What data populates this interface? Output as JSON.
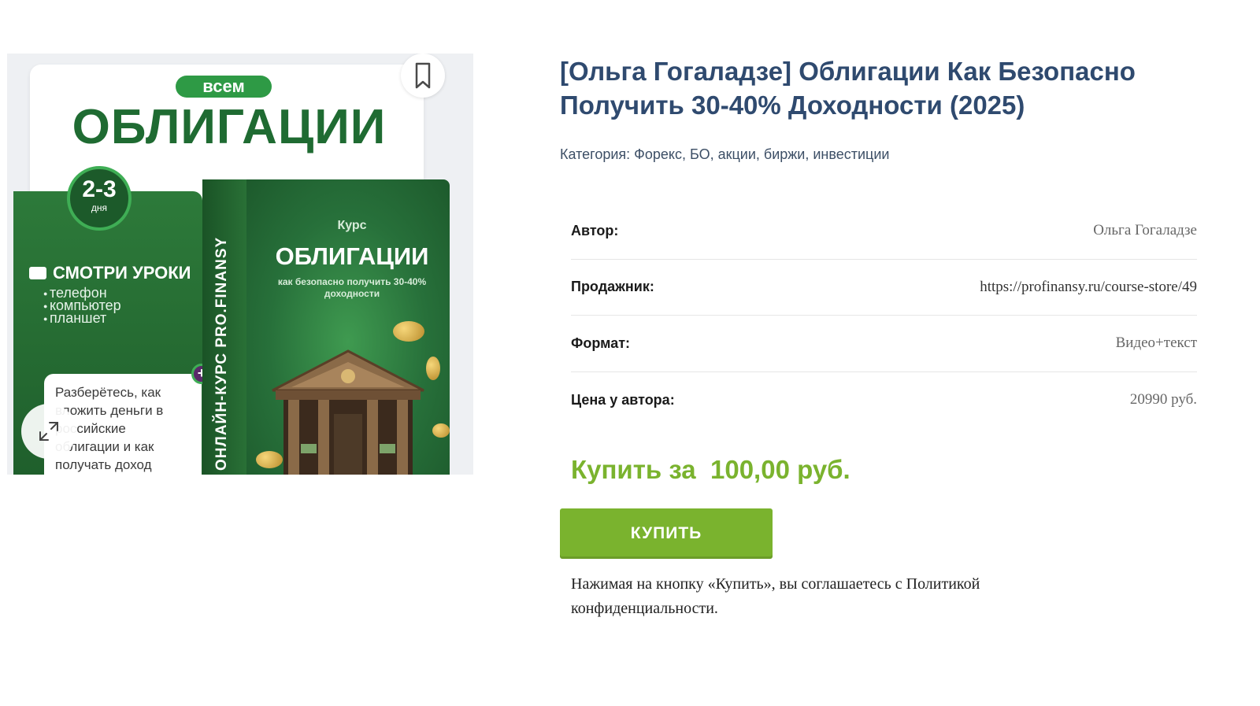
{
  "image": {
    "badge": "всем",
    "headline": "ОБЛИГАЦИИ",
    "days_number": "2-3",
    "days_label": "дня",
    "lessons_title": "СМОТРИ УРОКИ",
    "devices": [
      "телефон",
      "компьютер",
      "планшет"
    ],
    "note": "Разберётесь, как вложить деньги в российские облигации и как получать доход",
    "box_side": "ОНЛАЙН-КУРС PRO.FINANSY",
    "box_kurs": "Курс",
    "box_title": "ОБЛИГАЦИИ",
    "box_subtitle": "как безопасно получить 30-40% доходности"
  },
  "product": {
    "title": "[Ольга Гогаладзе] Облигации Как Безопасно Получить 30-40% Доходности (2025)",
    "category_label": "Категория:",
    "category_value": "Форекс, БО, акции, биржи, инвестиции"
  },
  "specs": [
    {
      "label": "Автор:",
      "value": "Ольга Гогаладзе"
    },
    {
      "label": "Продажник:",
      "value": "https://profinansy.ru/course-store/49"
    },
    {
      "label": "Формат:",
      "value": "Видео+текст"
    },
    {
      "label": "Цена у автора:",
      "value": "20990 руб."
    }
  ],
  "purchase": {
    "price_prefix": "Купить за",
    "price_value": "100,00 руб.",
    "button_label": "КУПИТЬ",
    "agreement": "Нажимая на кнопку «Купить», вы соглашаетесь с Политикой конфиденциальности."
  },
  "colors": {
    "accent_green": "#7ab32e",
    "title_blue": "#2f4a6f",
    "poster_green": "#1f6b32"
  },
  "icons": {
    "bookmark": "bookmark-icon",
    "expand": "expand-icon",
    "camera": "video-camera-icon"
  }
}
